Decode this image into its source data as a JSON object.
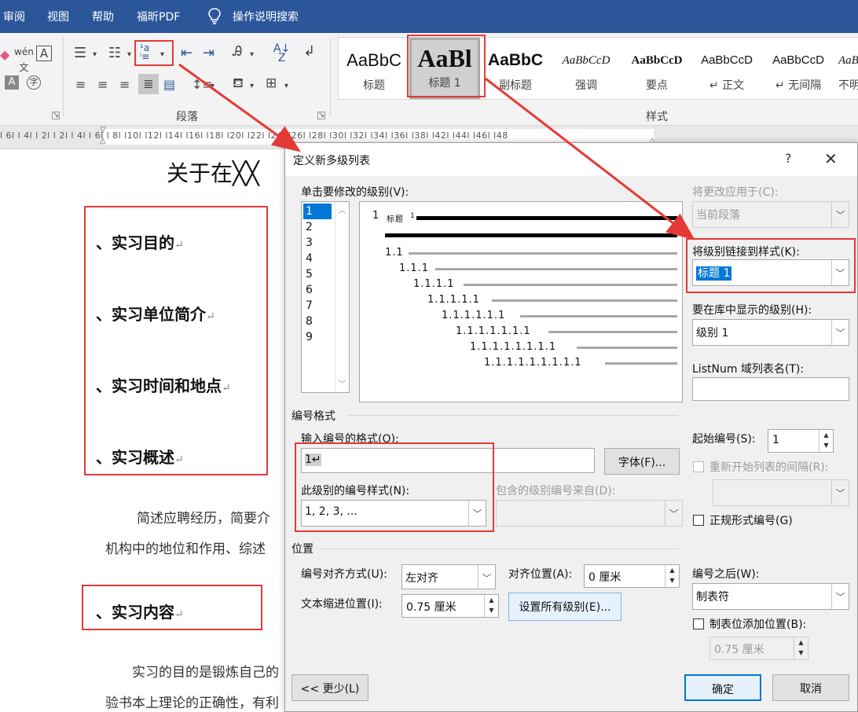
{
  "menu": {
    "items": [
      "审阅",
      "视图",
      "帮助",
      "福昕PDF"
    ],
    "search_label": "操作说明搜索"
  },
  "ribbon": {
    "paragraph_group_label": "段落",
    "styles_group_label": "样式",
    "styles": [
      {
        "sample": "AaBbC",
        "name": "标题"
      },
      {
        "sample": "AaBl",
        "name": "标题 1"
      },
      {
        "sample": "AaBbC",
        "name": "副标题"
      },
      {
        "sample": "AaBbCcD",
        "name": "强调"
      },
      {
        "sample": "AaBbCcD",
        "name": "要点"
      },
      {
        "sample": "AaBbCcD",
        "name": "↵ 正文"
      },
      {
        "sample": "AaBbCcD",
        "name": "↵ 无间隔"
      },
      {
        "sample": "AaB",
        "name": "不明"
      }
    ]
  },
  "ruler": {
    "marks": "l 6l  l 4l  l 2l     l 2l  l 4l  l 6l  l 8l  l10l  l12l  l14l  l16l  l18l  l20l  l22l  l24l  l26l  l28l  l30l  l32l  l34l  l36l  l38l     l42l  l44l  l46l  l48"
  },
  "document": {
    "title": "关于在╳╳",
    "headings": [
      "、实习目的",
      "、实习单位简介",
      "、实习时间和地点",
      "、实习概述",
      "、实习内容"
    ],
    "paragraph_mark": "↵",
    "body_lines": [
      "简述应聘经历，简要介",
      "机构中的地位和作用、综述",
      "实习的目的是锻炼自己的",
      "验书本上理论的正确性，有利"
    ]
  },
  "dialog": {
    "title": "定义新多级列表",
    "help": "?",
    "close": "✕",
    "click_level_label": "单击要修改的级别(V):",
    "levels": [
      "1",
      "2",
      "3",
      "4",
      "5",
      "6",
      "7",
      "8",
      "9"
    ],
    "selected_level": "1",
    "preview": {
      "first_num": "1",
      "first_style": "标题",
      "first_small": "1",
      "rows": [
        "1.1",
        "1.1.1",
        "1.1.1.1",
        "1.1.1.1.1",
        "1.1.1.1.1.1",
        "1.1.1.1.1.1.1",
        "1.1.1.1.1.1.1.1",
        "1.1.1.1.1.1.1.1.1"
      ]
    },
    "apply_to_label": "将更改应用于(C):",
    "apply_to_value": "当前段落",
    "link_style_label": "将级别链接到样式(K):",
    "link_style_value": "标题 1",
    "gallery_level_label": "要在库中显示的级别(H):",
    "gallery_level_value": "级别 1",
    "listnum_label": "ListNum 域列表名(T):",
    "listnum_value": "",
    "number_format_section": "编号格式",
    "enter_format_label": "输入编号的格式(O):",
    "enter_format_value": "1↵",
    "font_button": "字体(F)...",
    "number_style_label": "此级别的编号样式(N):",
    "number_style_value": "1, 2, 3, ...",
    "include_from_label": "包含的级别编号来自(D):",
    "start_at_label": "起始编号(S):",
    "start_at_value": "1",
    "restart_label": "重新开始列表的间隔(R):",
    "legal_label": "正规形式编号(G)",
    "position_section": "位置",
    "alignment_label": "编号对齐方式(U):",
    "alignment_value": "左对齐",
    "aligned_at_label": "对齐位置(A):",
    "aligned_at_value": "0 厘米",
    "follow_label": "编号之后(W):",
    "follow_value": "制表符",
    "indent_label": "文本缩进位置(I):",
    "indent_value": "0.75 厘米",
    "set_all_button": "设置所有级别(E)...",
    "tab_stop_label": "制表位添加位置(B):",
    "tab_stop_value": "0.75 厘米",
    "less_button": "<< 更少(L)",
    "ok_button": "确定",
    "cancel_button": "取消"
  },
  "colors": {
    "title_bar": "#2b579a",
    "annotation": "#e53935",
    "selection": "#0078d7"
  }
}
